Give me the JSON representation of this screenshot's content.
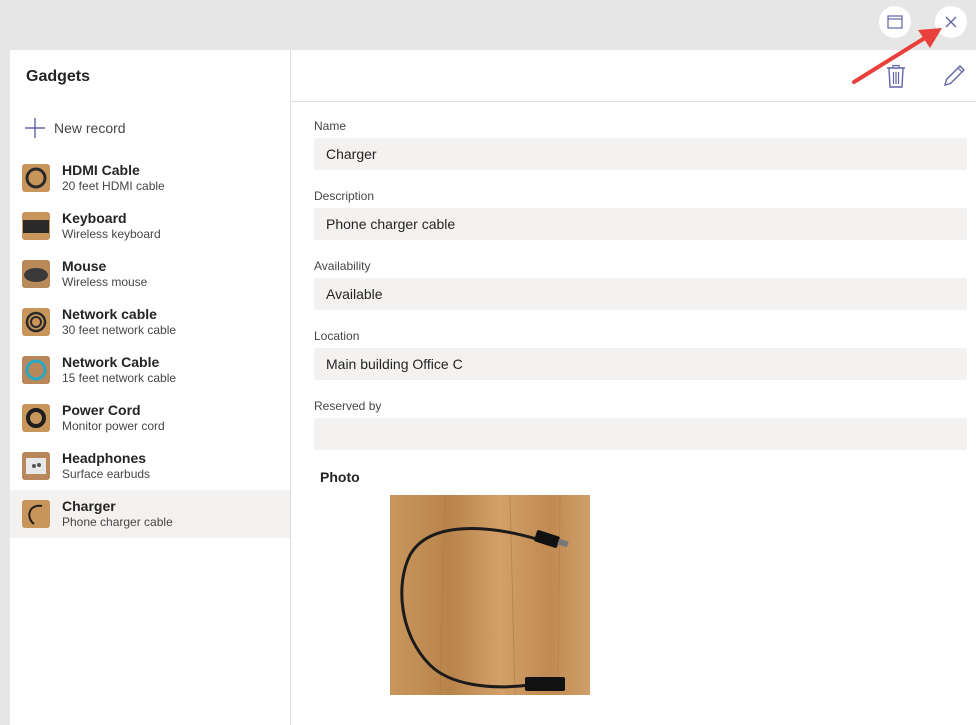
{
  "window": {
    "expand_icon": "window-restore-icon",
    "close_icon": "close-icon"
  },
  "sidebar": {
    "title": "Gadgets",
    "new_record_label": "New record",
    "items": [
      {
        "title": "HDMI Cable",
        "subtitle": "20 feet HDMI cable",
        "selected": false
      },
      {
        "title": "Keyboard",
        "subtitle": "Wireless keyboard",
        "selected": false
      },
      {
        "title": "Mouse",
        "subtitle": "Wireless mouse",
        "selected": false
      },
      {
        "title": "Network cable",
        "subtitle": "30 feet network cable",
        "selected": false
      },
      {
        "title": "Network Cable",
        "subtitle": "15 feet network cable",
        "selected": false
      },
      {
        "title": "Power Cord",
        "subtitle": "Monitor power cord",
        "selected": false
      },
      {
        "title": "Headphones",
        "subtitle": "Surface earbuds",
        "selected": false
      },
      {
        "title": "Charger",
        "subtitle": "Phone charger cable",
        "selected": true
      }
    ]
  },
  "toolbar": {
    "delete_icon": "trash-icon",
    "edit_icon": "pencil-icon"
  },
  "record": {
    "fields": [
      {
        "label": "Name",
        "value": "Charger"
      },
      {
        "label": "Description",
        "value": "Phone charger cable"
      },
      {
        "label": "Availability",
        "value": "Available"
      },
      {
        "label": "Location",
        "value": "Main building Office C"
      },
      {
        "label": "Reserved by",
        "value": ""
      }
    ],
    "photo_label": "Photo"
  },
  "colors": {
    "accent": "#6264a7",
    "annotation_arrow": "#e8403a",
    "selected_row": "#f3f2f1",
    "field_background": "#f3f2f1"
  }
}
